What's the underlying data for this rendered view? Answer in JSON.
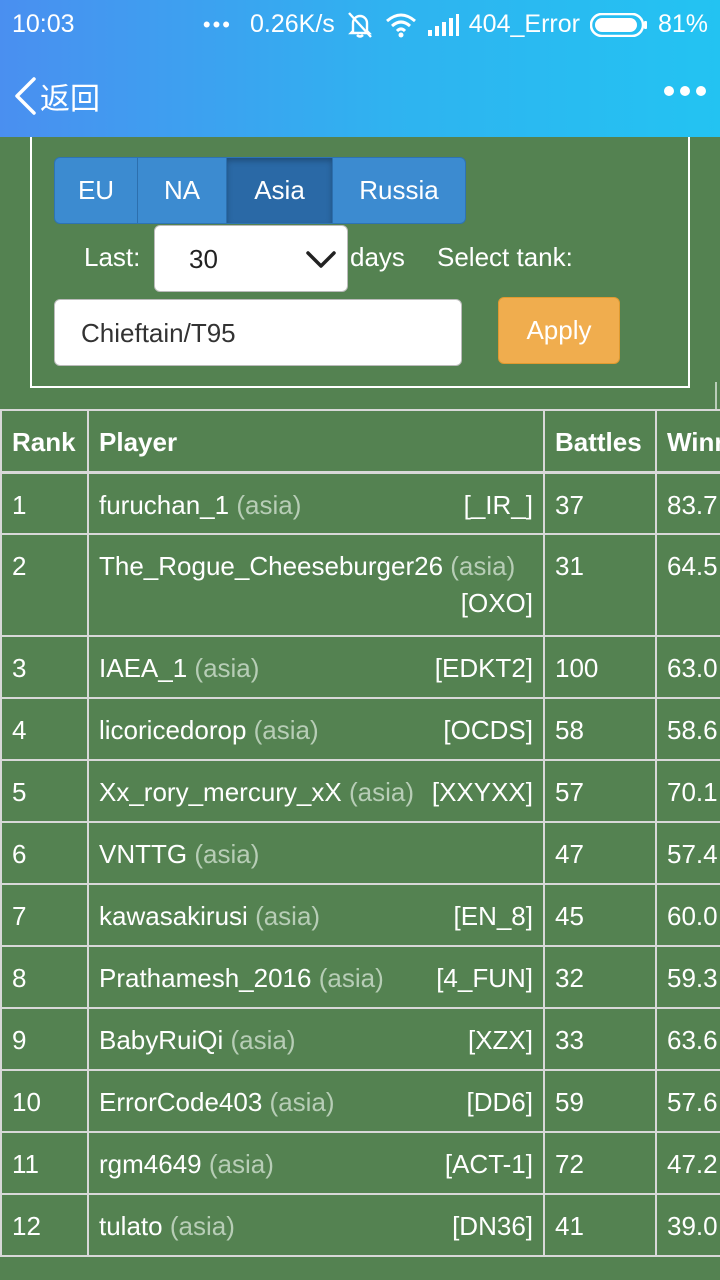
{
  "status_bar": {
    "time": "10:03",
    "speed": "0.26K/s",
    "carrier": "404_Error",
    "battery": "81%",
    "icons": [
      "more-dots-icon",
      "mute-vibrate-icon",
      "wifi-icon",
      "signal-icon",
      "battery-icon"
    ]
  },
  "header": {
    "back_label": "返回",
    "menu_icon": "more-dots-icon"
  },
  "filters": {
    "regions": [
      "EU",
      "NA",
      "Asia",
      "Russia"
    ],
    "active_region": "Asia",
    "last_label": "Last:",
    "days_value": "30",
    "days_label": "days",
    "tank_label": "Select tank:",
    "tank_value": "Chieftain/T95",
    "apply_label": "Apply",
    "accent_color": "#f0ad4e",
    "segment_color": "#3c8bd0"
  },
  "table": {
    "headers": [
      "Rank",
      "Player",
      "Battles",
      "Winr"
    ],
    "rows": [
      {
        "rank": "1",
        "player": "furuchan_1",
        "region": "(asia)",
        "clan": "[_IR_]",
        "battles": "37",
        "winrate": "83.7"
      },
      {
        "rank": "2",
        "player": "The_Rogue_Cheeseburger26",
        "region": "(asia)",
        "clan": "[OXO]",
        "battles": "31",
        "winrate": "64.5"
      },
      {
        "rank": "3",
        "player": "IAEA_1",
        "region": "(asia)",
        "clan": "[EDKT2]",
        "battles": "100",
        "winrate": "63.0"
      },
      {
        "rank": "4",
        "player": "licoricedorop",
        "region": "(asia)",
        "clan": "[OCDS]",
        "battles": "58",
        "winrate": "58.6"
      },
      {
        "rank": "5",
        "player": "Xx_rory_mercury_xX",
        "region": "(asia)",
        "clan": "[XXYXX]",
        "battles": "57",
        "winrate": "70.1"
      },
      {
        "rank": "6",
        "player": "VNTTG",
        "region": "(asia)",
        "clan": "",
        "battles": "47",
        "winrate": "57.4"
      },
      {
        "rank": "7",
        "player": "kawasakirusi",
        "region": "(asia)",
        "clan": "[EN_8]",
        "battles": "45",
        "winrate": "60.0"
      },
      {
        "rank": "8",
        "player": "Prathamesh_2016",
        "region": "(asia)",
        "clan": "[4_FUN]",
        "battles": "32",
        "winrate": "59.3"
      },
      {
        "rank": "9",
        "player": "BabyRuiQi",
        "region": "(asia)",
        "clan": "[XZX]",
        "battles": "33",
        "winrate": "63.6"
      },
      {
        "rank": "10",
        "player": "ErrorCode403",
        "region": "(asia)",
        "clan": "[DD6]",
        "battles": "59",
        "winrate": "57.6"
      },
      {
        "rank": "11",
        "player": "rgm4649",
        "region": "(asia)",
        "clan": "[ACT-1]",
        "battles": "72",
        "winrate": "47.2"
      },
      {
        "rank": "12",
        "player": "tulato",
        "region": "(asia)",
        "clan": "[DN36]",
        "battles": "41",
        "winrate": "39.0"
      }
    ]
  }
}
